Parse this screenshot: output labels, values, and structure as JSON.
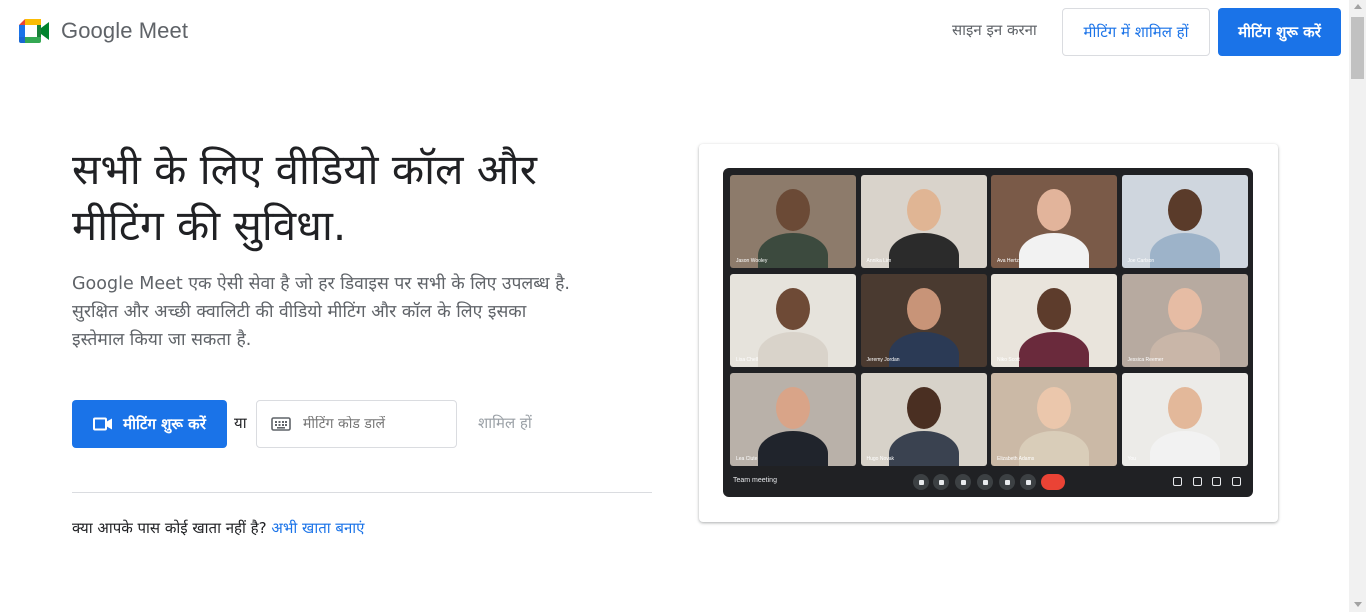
{
  "header": {
    "logo_text": "Google Meet",
    "signin_label": "साइन इन करना",
    "join_meeting_label": "मीटिंग में शामिल हों",
    "start_meeting_label": "मीटिंग शुरू करें"
  },
  "hero": {
    "title_line1": "सभी के लिए वीडियो कॉल और",
    "title_line2": "मीटिंग की सुविधा.",
    "subtitle_line1": "Google Meet एक ऐसी सेवा है जो हर डिवाइस पर सभी के लिए उपलब्ध है.",
    "subtitle_line2": "सुरक्षित और अच्छी क्वालिटी की वीडियो मीटिंग और कॉल के लिए इसका",
    "subtitle_line3": "इस्तेमाल किया जा सकता है.",
    "start_button_label": "मीटिंग शुरू करें",
    "or_text": "या",
    "code_placeholder": "मीटिंग कोड डालें",
    "join_label": "शामिल हों",
    "no_account_text": "क्या आपके पास कोई खाता नहीं है?",
    "create_account_label": "अभी खाता बनाएं"
  },
  "illustration": {
    "meeting_name": "Team meeting",
    "participants": [
      {
        "name": "Jason Wooley",
        "bg": "#8d7b6b",
        "skin": "#6b4a36",
        "shirt": "#3c4a3e"
      },
      {
        "name": "Annika Lim",
        "bg": "#d9d3cb",
        "skin": "#e0b594",
        "shirt": "#2b2b2b"
      },
      {
        "name": "Ava Hertz",
        "bg": "#7a5a48",
        "skin": "#e2b49b",
        "shirt": "#f2f2f2"
      },
      {
        "name": "Joe Carlson",
        "bg": "#cfd6de",
        "skin": "#5a3b2a",
        "shirt": "#9db3c9"
      },
      {
        "name": "Lisa Chell",
        "bg": "#e6e3dc",
        "skin": "#6e4a36",
        "shirt": "#d9d3ca"
      },
      {
        "name": "Jeremy Jordan",
        "bg": "#4a3a30",
        "skin": "#c89478",
        "shirt": "#2b3a55"
      },
      {
        "name": "Niko Scott",
        "bg": "#e9e4dc",
        "skin": "#5d3c2c",
        "shirt": "#6a2a3c"
      },
      {
        "name": "Jessica Reemer",
        "bg": "#b7aaa0",
        "skin": "#e6bca4",
        "shirt": "#c9b6a8"
      },
      {
        "name": "Lea Clute",
        "bg": "#b9b1a9",
        "skin": "#d9a488",
        "shirt": "#20242c"
      },
      {
        "name": "Hugo Novak",
        "bg": "#d7d2c9",
        "skin": "#4a2f22",
        "shirt": "#3a4250"
      },
      {
        "name": "Elizabeth Adams",
        "bg": "#cbb9a6",
        "skin": "#ebc7ac",
        "shirt": "#d9cdb9"
      },
      {
        "name": "You",
        "bg": "#ecebe8",
        "skin": "#e3b89a",
        "shirt": "#f2f2f2"
      }
    ]
  }
}
